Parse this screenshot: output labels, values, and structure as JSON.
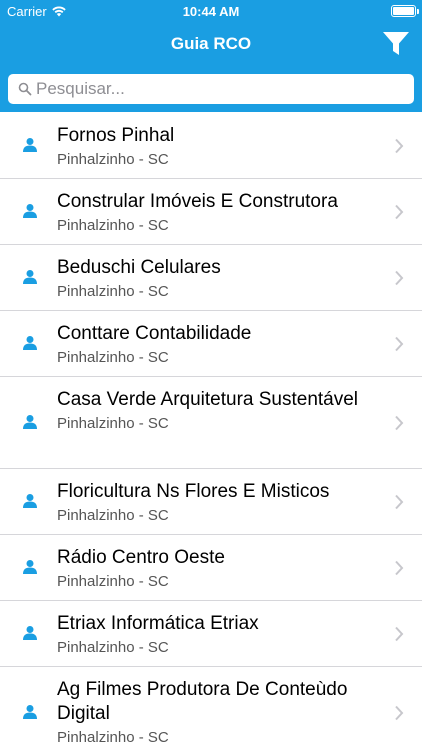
{
  "status": {
    "carrier": "Carrier",
    "time": "10:44 AM"
  },
  "nav": {
    "title": "Guia RCO"
  },
  "search": {
    "placeholder": "Pesquisar..."
  },
  "colors": {
    "accent": "#1a9ee2",
    "icon": "#1a9ee2",
    "separator": "#d6d6da",
    "chevron": "#c7c7cc"
  },
  "items": [
    {
      "name": "Fornos Pinhal",
      "city": "Pinhalzinho - SC"
    },
    {
      "name": "Constrular Imóveis E Construtora",
      "city": "Pinhalzinho - SC"
    },
    {
      "name": "Beduschi Celulares",
      "city": "Pinhalzinho - SC"
    },
    {
      "name": "Conttare Contabilidade",
      "city": "Pinhalzinho - SC"
    },
    {
      "name": "Casa Verde Arquitetura Sustentável",
      "city": "Pinhalzinho - SC"
    },
    {
      "name": "Floricultura Ns Flores E Misticos",
      "city": "Pinhalzinho - SC"
    },
    {
      "name": "Rádio Centro Oeste",
      "city": "Pinhalzinho - SC"
    },
    {
      "name": "Etriax Informática Etriax",
      "city": "Pinhalzinho - SC"
    },
    {
      "name": "Ag Filmes Produtora De Conteùdo Digital",
      "city": "Pinhalzinho - SC"
    }
  ]
}
